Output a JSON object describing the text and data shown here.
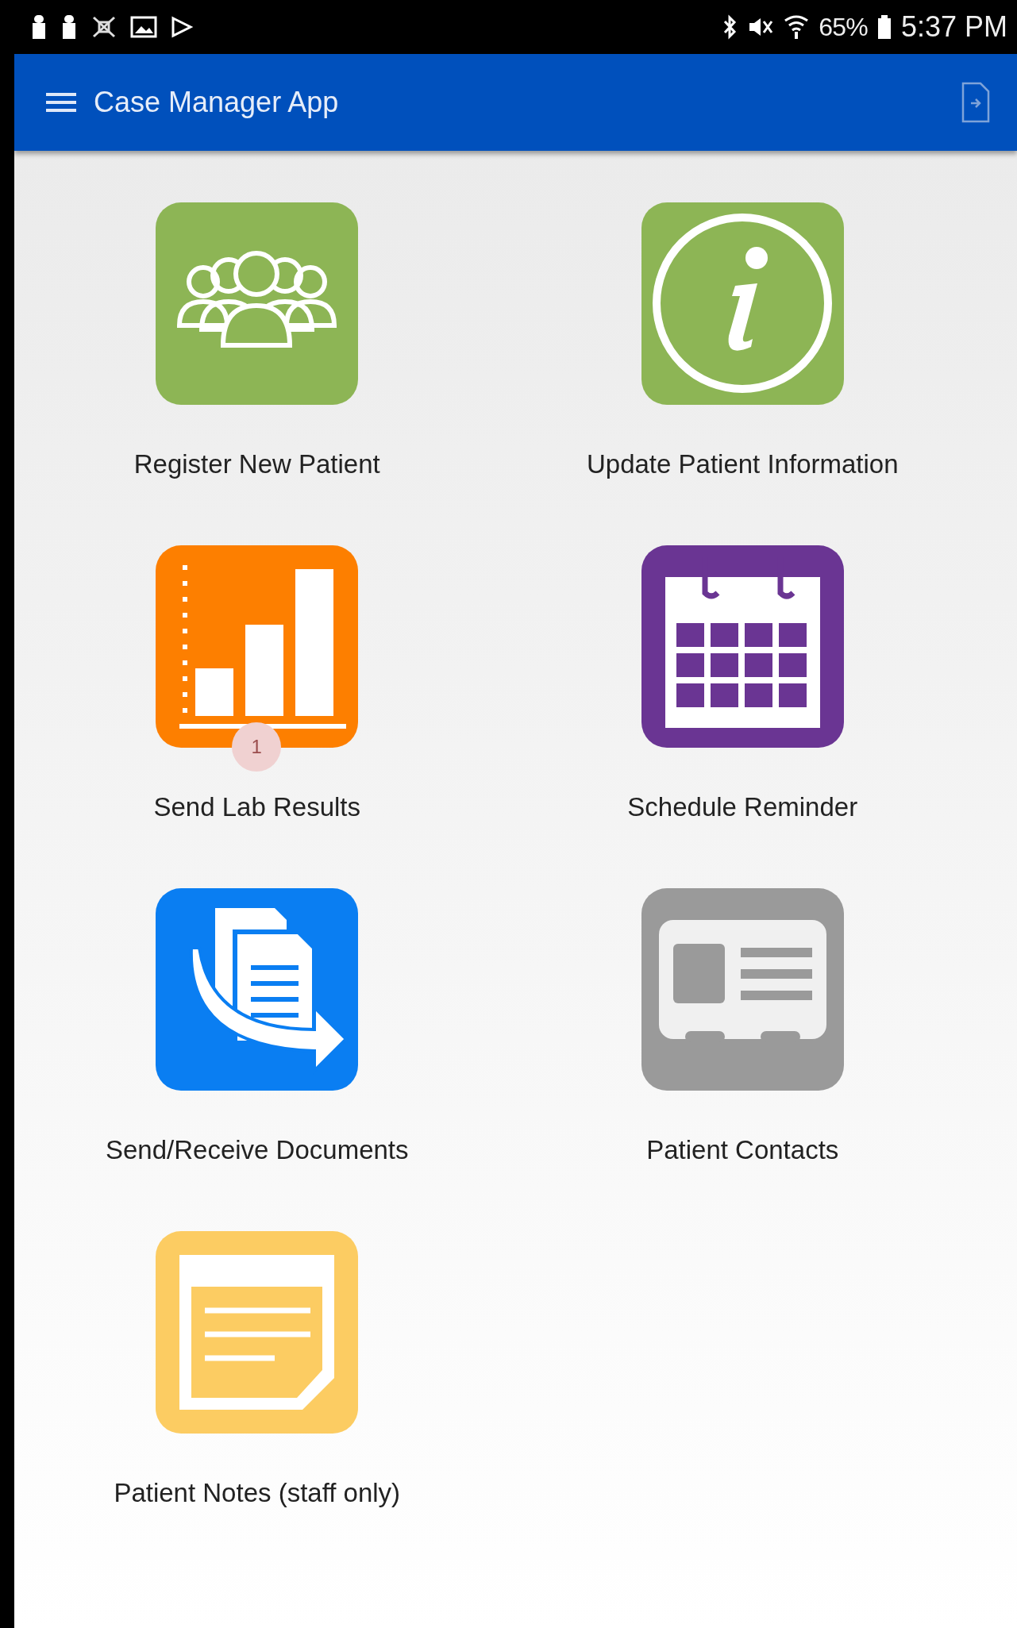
{
  "status_bar": {
    "battery": "65%",
    "time": "5:37 PM"
  },
  "app_bar": {
    "title": "Case Manager App"
  },
  "tiles": [
    {
      "kind": "people",
      "label": "Register New Patient"
    },
    {
      "kind": "info",
      "label": "Update Patient Information"
    },
    {
      "kind": "chart",
      "label": "Send Lab Results",
      "badge": "1"
    },
    {
      "kind": "calendar",
      "label": "Schedule Reminder"
    },
    {
      "kind": "documents",
      "label": "Send/Receive Documents"
    },
    {
      "kind": "contact-card",
      "label": "Patient Contacts"
    },
    {
      "kind": "notes",
      "label": "Patient Notes (staff only)"
    }
  ]
}
